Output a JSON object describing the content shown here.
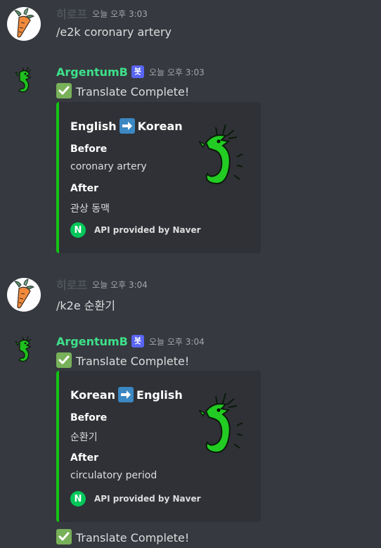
{
  "messages": [
    {
      "username": "히로프",
      "timestamp": "오늘 오후 3:03",
      "text": "/e2k coronary artery"
    },
    {
      "username": "ArgentumB",
      "bot_tag": "봇",
      "timestamp": "오늘 오후 3:03",
      "text": "Translate Complete!",
      "embed": {
        "from_lang": "English",
        "to_lang": "Korean",
        "before_label": "Before",
        "before_value": "coronary artery",
        "after_label": "After",
        "after_value": "관상 동맥",
        "footer": "API provided by Naver",
        "footer_icon_letter": "N"
      }
    },
    {
      "username": "히로프",
      "timestamp": "오늘 오후 3:04",
      "text": "/k2e 순환기"
    },
    {
      "username": "ArgentumB",
      "bot_tag": "봇",
      "timestamp": "오늘 오후 3:04",
      "text": "Translate Complete!",
      "embed": {
        "from_lang": "Korean",
        "to_lang": "English",
        "before_label": "Before",
        "before_value": "순환기",
        "after_label": "After",
        "after_value": "circulatory period",
        "footer": "API provided by Naver",
        "footer_icon_letter": "N"
      }
    },
    {
      "text": "Translate Complete!"
    }
  ],
  "icons": {
    "user_avatar": "carrot-icon",
    "bot_avatar": "dragon-icon",
    "check": "check-mark-icon",
    "arrow": "right-arrow-icon",
    "footer": "naver-icon"
  },
  "colors": {
    "background": "#36393f",
    "embed_bg": "#2f3136",
    "embed_border": "#14c214",
    "bot_name": "#3ee08a",
    "user_name": "#4f545c",
    "bot_tag": "#5865f2"
  }
}
